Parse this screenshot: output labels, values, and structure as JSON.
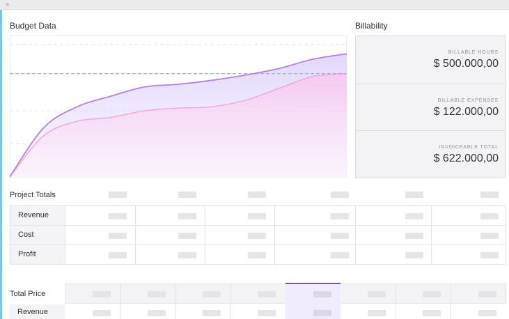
{
  "budget": {
    "title": "Budget Data"
  },
  "billability": {
    "title": "Billability",
    "cards": [
      {
        "label": "BILLABLE HOURS",
        "value": "$ 500.000,00"
      },
      {
        "label": "BILLABLE EXPENSES",
        "value": "$ 122.000,00"
      },
      {
        "label": "INVOICEABLE TOTAL",
        "value": "$ 622.000,00"
      }
    ]
  },
  "project_totals": {
    "title": "Project Totals",
    "rows": [
      "Revenue",
      "Cost",
      "Profit"
    ]
  },
  "total_price": {
    "title": "Total Price",
    "rows": [
      "Revenue"
    ]
  },
  "colors": {
    "accent": "#7a48d8",
    "series_primary": "#b67ee8",
    "series_secondary": "#f0a8e0",
    "target_line": "#7aa6d6",
    "left_accent": "#7fc4ec"
  },
  "chart_data": {
    "type": "area",
    "title": "Budget Data",
    "x": [
      0,
      1,
      2,
      3,
      4,
      5,
      6,
      7,
      8,
      9,
      10
    ],
    "series": [
      {
        "values": [
          0,
          37,
          53,
          61,
          68,
          70,
          73,
          77,
          82,
          89,
          93
        ]
      },
      {
        "values": [
          0,
          31,
          42,
          45,
          50,
          52,
          53,
          58,
          67,
          76,
          78
        ]
      }
    ],
    "target": 78,
    "ylim": [
      0,
      100
    ],
    "grid": true
  }
}
